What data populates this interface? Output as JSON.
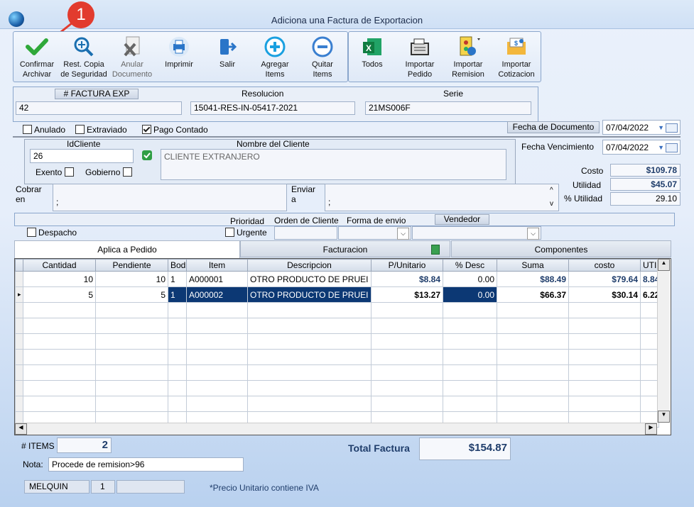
{
  "window": {
    "title": "Adiciona una Factura de Exportacion",
    "callout_number": "1"
  },
  "toolbar": {
    "confirmar": "Confirmar\nArchivar",
    "rest_copia": "Rest. Copia\nde Seguridad",
    "anular": "Anular\nDocumento",
    "imprimir": "Imprimir",
    "salir": "Salir",
    "agregar": "Agregar\nItems",
    "quitar": "Quitar\nItems",
    "todos": "Todos",
    "importar_pedido": "Importar\nPedido",
    "importar_remision": "Importar\nRemision",
    "importar_cotizacion": "Importar\nCotizacion"
  },
  "header": {
    "factura_label": "# FACTURA EXP",
    "factura_value": "42",
    "resolucion_label": "Resolucion",
    "resolucion_value": "15041-RES-IN-05417-2021",
    "serie_label": "Serie",
    "serie_value": "21MS006F"
  },
  "flags": {
    "anulado": "Anulado",
    "extraviado": "Extraviado",
    "pago_contado": "Pago Contado"
  },
  "dates": {
    "fecha_documento_label": "Fecha de  Documento",
    "fecha_documento": "07/04/2022",
    "fecha_vencimiento_label": "Fecha Vencimiento",
    "fecha_vencimiento": "07/04/2022"
  },
  "cliente": {
    "id_label": "IdCliente",
    "id_value": "26",
    "nombre_label": "Nombre del Cliente",
    "nombre_value": "CLIENTE EXTRANJERO",
    "exento": "Exento",
    "gobierno": "Gobierno"
  },
  "totals_side": {
    "costo_label": "Costo",
    "costo": "$109.78",
    "utilidad_label": "Utilidad",
    "utilidad": "$45.07",
    "pct_label": "% Utilidad",
    "pct": "29.10"
  },
  "cobrar": {
    "label1": "Cobrar",
    "label2": "en",
    "value": ";"
  },
  "enviar": {
    "label1": "Enviar",
    "label2": "a",
    "value": ";"
  },
  "shipping": {
    "prioridad": "Prioridad",
    "orden": "Orden de Cliente",
    "forma": "Forma de envio",
    "vendedor": "Vendedor",
    "despacho": "Despacho",
    "urgente": "Urgente"
  },
  "tabs": [
    "Aplica a Pedido",
    "Facturacion",
    "Componentes"
  ],
  "grid": {
    "columns": [
      "Cantidad",
      "Pendiente",
      "Bod",
      "Item",
      "Descripcion",
      "P/Unitario",
      "% Desc",
      "Suma",
      "costo",
      "UTIL"
    ],
    "rows": [
      [
        "10",
        "10",
        "1",
        "A000001",
        "OTRO PRODUCTO DE PRUEI",
        "$8.84",
        "0.00",
        "$88.49",
        "$79.64",
        "8.84"
      ],
      [
        "5",
        "5",
        "1",
        "A000002",
        "OTRO PRODUCTO DE PRUEI",
        "$13.27",
        "0.00",
        "$66.37",
        "$30.14",
        "6.22"
      ]
    ]
  },
  "footer": {
    "items_label": "# ITEMS",
    "items_value": "2",
    "total_label": "Total Factura",
    "total_value": "$154.87",
    "nota_label": "Nota:",
    "nota_value": "Procede de remision>96",
    "user": "MELQUIN",
    "user_num": "1",
    "precio_note": "*Precio Unitario contiene IVA"
  }
}
